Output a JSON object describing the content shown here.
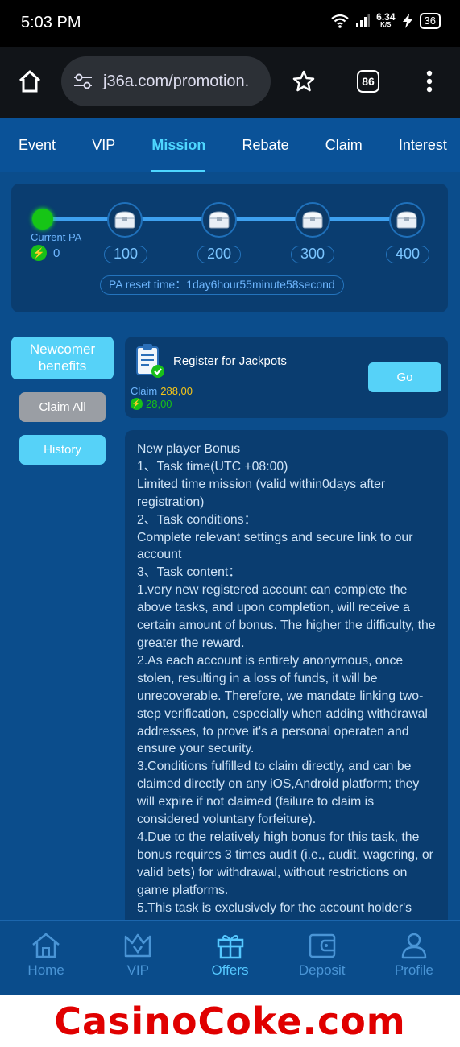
{
  "status_bar": {
    "time": "5:03 PM",
    "speed_value": "6.34",
    "speed_unit": "K/S",
    "battery": "36"
  },
  "browser": {
    "url": "j36a.com/promotion.",
    "tab_count": "86"
  },
  "tabs": [
    {
      "label": "Event",
      "active": false
    },
    {
      "label": "VIP",
      "active": false
    },
    {
      "label": "Mission",
      "active": true
    },
    {
      "label": "Rebate",
      "active": false
    },
    {
      "label": "Claim",
      "active": false
    },
    {
      "label": "Interest",
      "active": false
    }
  ],
  "progress": {
    "current_label": "Current PA",
    "current_value": "0",
    "levels": [
      "100",
      "200",
      "300",
      "400"
    ],
    "reset_text": "PA reset time：1day6hour55minute58second"
  },
  "side_menu": {
    "newcomer": "Newcomer benefits",
    "claim_all": "Claim All",
    "history": "History"
  },
  "mission": {
    "title": "Register for Jackpots",
    "claim_label": "Claim",
    "claim_value": "288,00",
    "pa_value": "28,00",
    "go_label": "Go"
  },
  "description": [
    "New player Bonus",
    "1、Task time(UTC +08:00)",
    "Limited time mission (valid within0days after registration)",
    "2、Task conditions：",
    "Complete relevant settings and secure link to our account",
    "3、Task content：",
    "1.very new registered account can complete the above tasks, and upon completion, will receive a certain amount of bonus. The higher the difficulty, the greater the reward.",
    "2.As each account is entirely anonymous, once stolen, resulting in a loss of funds, it will be unrecoverable. Therefore, we mandate linking two-step verification, especially when adding withdrawal addresses, to prove it's a personal operaten and ensure your security.",
    "3.Conditions fulfilled to claim directly, and can be claimed directly on any iOS,Android platform; they will expire if not claimed (failure to claim is considered voluntary forfeiture).",
    "4.Due to the relatively high bonus for this task, the bonus requires 3 times audit (i.e., audit, wagering, or valid bets) for withdrawal, without restrictions on game platforms.",
    "5.This task is exclusively for the account holder's"
  ],
  "bottom_nav": [
    {
      "label": "Home",
      "icon": "home-icon",
      "active": false
    },
    {
      "label": "VIP",
      "icon": "crown-icon",
      "active": false
    },
    {
      "label": "Offers",
      "icon": "gift-icon",
      "active": true
    },
    {
      "label": "Deposit",
      "icon": "wallet-icon",
      "active": false
    },
    {
      "label": "Profile",
      "icon": "person-icon",
      "active": false
    }
  ],
  "watermark": "CasinoCoke.com",
  "colors": {
    "accent": "#4ed6ff",
    "background": "#0b4d8c",
    "card": "#0a3d70",
    "gold": "#f5c518",
    "green": "#18c018",
    "watermark": "#e00000"
  }
}
